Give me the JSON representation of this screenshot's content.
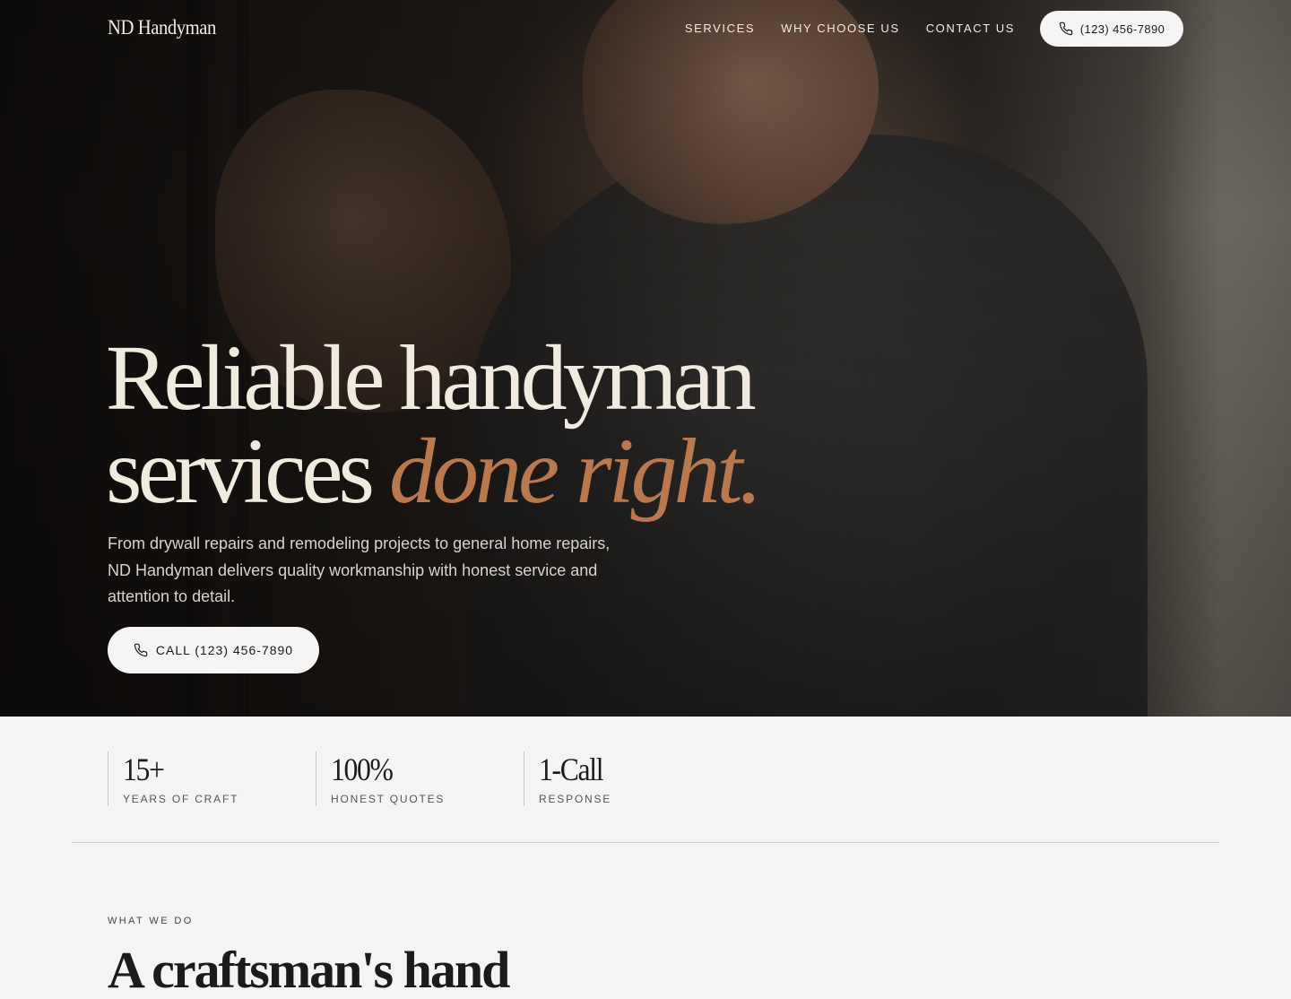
{
  "brand": {
    "logo": "ND Handyman"
  },
  "nav": {
    "links": [
      "SERVICES",
      "WHY CHOOSE US",
      "CONTACT US"
    ],
    "phone_button": "(123) 456-7890"
  },
  "hero": {
    "headline_line1": "Reliable handyman",
    "headline_line2_plain": "services ",
    "headline_line2_accent": "done right.",
    "subtext": "From drywall repairs and remodeling projects to general home repairs, ND Handyman delivers quality workmanship with honest service and attention to detail.",
    "cta_label": "CALL (123) 456-7890"
  },
  "stats": [
    {
      "value": "15+",
      "label": "YEARS OF CRAFT"
    },
    {
      "value": "100%",
      "label": "HONEST QUOTES"
    },
    {
      "value": "1-Call",
      "label": "RESPONSE"
    }
  ],
  "section": {
    "eyebrow": "WHAT WE DO",
    "title": "A craftsman's hand"
  },
  "colors": {
    "accent": "#b9784d",
    "headline": "#f1eadf",
    "page_bg": "#f3f4f6",
    "button_bg": "#f6f5f3"
  }
}
